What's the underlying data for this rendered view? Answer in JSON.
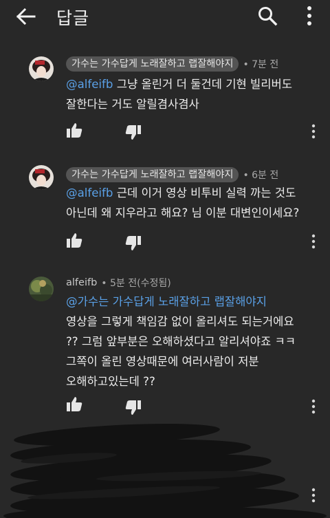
{
  "header": {
    "title": "답글",
    "back_icon": "arrow-left-icon",
    "search_icon": "search-icon",
    "more_icon": "more-vert-icon"
  },
  "comments": [
    {
      "author": "가수는 가수답게 노래잘하고 랩잘해야지",
      "time": "• 7분 전",
      "mention": "@alfeifb",
      "line1_rest": " 그냥 올린거 더 둘건데 기현 빌리버도",
      "line2": "잘한다는 거도 알릴겸사겸사"
    },
    {
      "author": "가수는 가수답게 노래잘하고 랩잘해야지",
      "time": "• 6분 전",
      "mention": "@alfeifb",
      "line1_rest": " 근데 이거 영상 비투비 실력 까는 것도",
      "line2": "아닌데 왜 지우라고 해요? 님 이분 대변인이세요?"
    },
    {
      "author": "alfeifb",
      "time": "• 5분 전(수정됨)",
      "mention": "@가수는 가수답게 노래잘하고 랩잘해야지",
      "line2": "영상을 그렇게 책임감 없이 올리셔도 되는거에요",
      "line3": "?? 그럼 앞부분은 오해하셨다고 알리셔야죠 ㅋㅋ",
      "line4": "그쪽이 올린 영상때문에 여러사람이 저분",
      "line5": "오해하고있는데 ??"
    }
  ],
  "colors": {
    "background": "#282828",
    "mention": "#5aa0e6",
    "chip": "#545454"
  }
}
